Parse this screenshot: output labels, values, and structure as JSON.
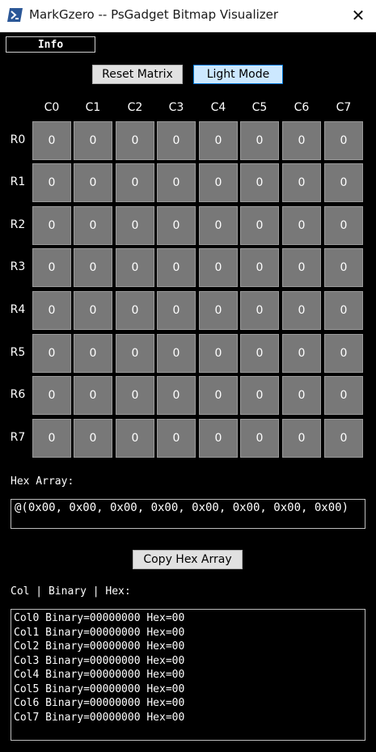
{
  "window": {
    "title": "MarkGzero -- PsGadget Bitmap Visualizer",
    "close_symbol": "✕",
    "icon": "powershell-icon"
  },
  "info_tab": {
    "label": "Info"
  },
  "toolbar": {
    "reset_label": "Reset Matrix",
    "light_mode_label": "Light Mode"
  },
  "matrix": {
    "col_headers": [
      "C0",
      "C1",
      "C2",
      "C3",
      "C4",
      "C5",
      "C6",
      "C7"
    ],
    "row_headers": [
      "R0",
      "R1",
      "R2",
      "R3",
      "R4",
      "R5",
      "R6",
      "R7"
    ],
    "cells": [
      [
        "0",
        "0",
        "0",
        "0",
        "0",
        "0",
        "0",
        "0"
      ],
      [
        "0",
        "0",
        "0",
        "0",
        "0",
        "0",
        "0",
        "0"
      ],
      [
        "0",
        "0",
        "0",
        "0",
        "0",
        "0",
        "0",
        "0"
      ],
      [
        "0",
        "0",
        "0",
        "0",
        "0",
        "0",
        "0",
        "0"
      ],
      [
        "0",
        "0",
        "0",
        "0",
        "0",
        "0",
        "0",
        "0"
      ],
      [
        "0",
        "0",
        "0",
        "0",
        "0",
        "0",
        "0",
        "0"
      ],
      [
        "0",
        "0",
        "0",
        "0",
        "0",
        "0",
        "0",
        "0"
      ],
      [
        "0",
        "0",
        "0",
        "0",
        "0",
        "0",
        "0",
        "0"
      ]
    ],
    "cell_color": "#787878"
  },
  "hex_section": {
    "label": "Hex Array:",
    "value": "@(0x00, 0x00, 0x00, 0x00, 0x00, 0x00, 0x00, 0x00)",
    "copy_label": "Copy Hex Array"
  },
  "binary_section": {
    "label": "Col | Binary | Hex:",
    "lines": [
      "Col0 Binary=00000000 Hex=00",
      "Col1 Binary=00000000 Hex=00",
      "Col2 Binary=00000000 Hex=00",
      "Col3 Binary=00000000 Hex=00",
      "Col4 Binary=00000000 Hex=00",
      "Col5 Binary=00000000 Hex=00",
      "Col6 Binary=00000000 Hex=00",
      "Col7 Binary=00000000 Hex=00"
    ]
  }
}
